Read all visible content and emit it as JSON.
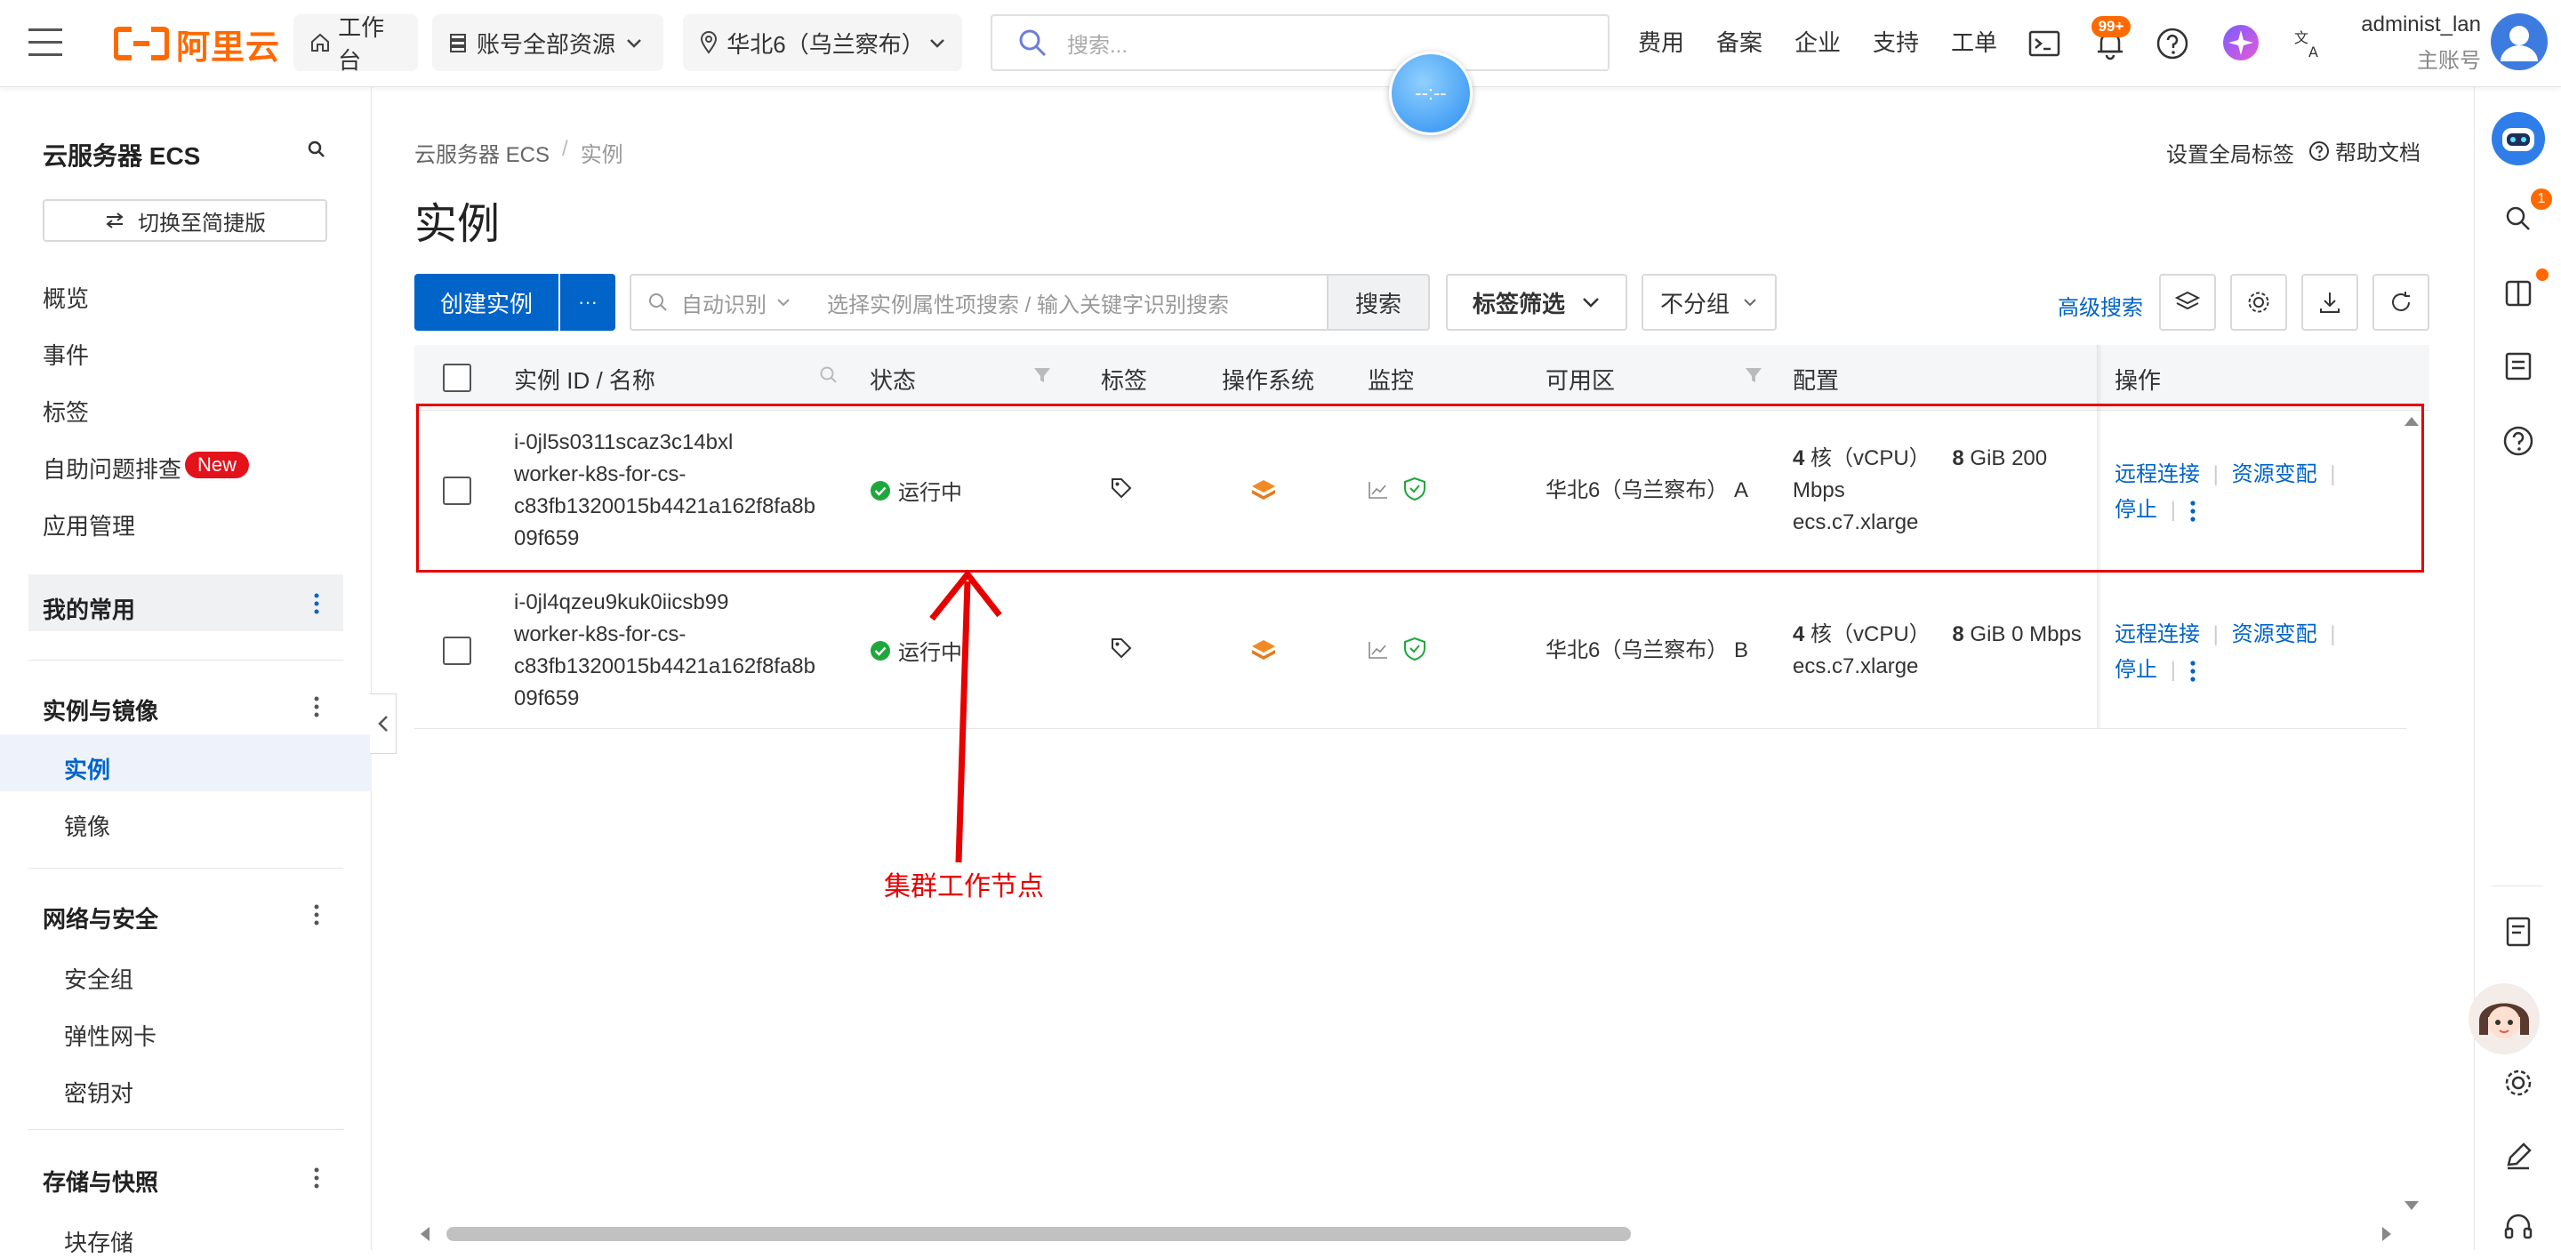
{
  "topbar": {
    "logo_text": "阿里云",
    "workbench": "工作台",
    "resources": "账号全部资源",
    "region": "华北6（乌兰察布）",
    "search_placeholder": "搜索...",
    "links": [
      "费用",
      "备案",
      "企业",
      "支持",
      "工单"
    ],
    "notification_badge": "99+",
    "user_name": "administ_lan",
    "user_role": "主账号"
  },
  "sidebar": {
    "title": "云服务器 ECS",
    "switch_button": "切换至简捷版",
    "items": [
      "概览",
      "事件",
      "标签",
      "自助问题排查",
      "应用管理"
    ],
    "new_badge": "New",
    "groups": [
      {
        "title": "我的常用",
        "items": []
      },
      {
        "title": "实例与镜像",
        "items": [
          "实例",
          "镜像"
        ]
      },
      {
        "title": "网络与安全",
        "items": [
          "安全组",
          "弹性网卡",
          "密钥对"
        ]
      },
      {
        "title": "存储与快照",
        "items": [
          "块存储"
        ]
      }
    ]
  },
  "main": {
    "breadcrumb": [
      "云服务器 ECS",
      "实例"
    ],
    "page_title": "实例",
    "global_tag": "设置全局标签",
    "help_doc": "帮助文档",
    "create_button": "创建实例",
    "more_button": "···",
    "auto_identify": "自动识别",
    "search_placeholder": "选择实例属性项搜索 / 输入关键字识别搜索",
    "search_button": "搜索",
    "tag_filter": "标签筛选",
    "group_select": "不分组",
    "advanced_search": "高级搜索"
  },
  "table": {
    "headers": [
      "实例 ID / 名称",
      "状态",
      "标签",
      "操作系统",
      "监控",
      "可用区",
      "配置",
      "操作"
    ],
    "rows": [
      {
        "id": "i-0jl5s0311scaz3c14bxl",
        "name_lines": [
          "worker-k8s-for-cs-",
          "c83fb1320015b4421a162f8fa8b",
          "09f659"
        ],
        "status": "运行中",
        "zone": "华北6（乌兰察布） A",
        "cpu_num": "4",
        "cpu_text": "核（vCPU）",
        "mem_num": "8",
        "mem_text": "GiB 200",
        "bw_line": "Mbps",
        "spec": "ecs.c7.xlarge",
        "actions": [
          "远程连接",
          "资源变配",
          "停止"
        ]
      },
      {
        "id": "i-0jl4qzeu9kuk0iicsb99",
        "name_lines": [
          "worker-k8s-for-cs-",
          "c83fb1320015b4421a162f8fa8b",
          "09f659"
        ],
        "status": "运行中",
        "zone": "华北6（乌兰察布） B",
        "cpu_num": "4",
        "cpu_text": "核（vCPU）",
        "mem_num": "8",
        "mem_text": "GiB 0 Mbps",
        "bw_line": "",
        "spec": "ecs.c7.xlarge",
        "actions": [
          "远程连接",
          "资源变配",
          "停止"
        ]
      }
    ]
  },
  "annotation": {
    "label": "集群工作节点",
    "color": "#e60000"
  },
  "floating_badge_text": "--:--",
  "rail_badge": "1",
  "colors": {
    "brand_orange": "#ff6a00",
    "primary_blue": "#0064c8",
    "success_green": "#1ea83c",
    "annotation_red": "#e60000"
  }
}
